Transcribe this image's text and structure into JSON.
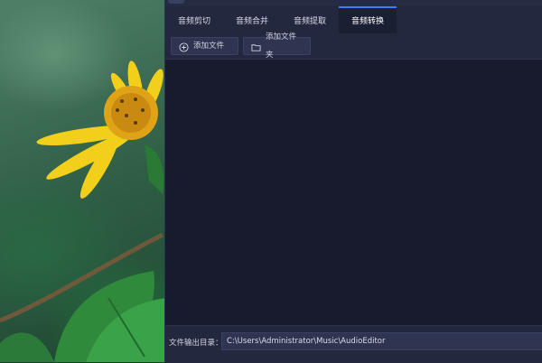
{
  "tabs": [
    {
      "label": "音频剪切",
      "active": false
    },
    {
      "label": "音频合并",
      "active": false
    },
    {
      "label": "音频提取",
      "active": false
    },
    {
      "label": "音频转换",
      "active": true
    }
  ],
  "toolbar": {
    "add_file_label": "添加文件",
    "add_folder_label": "添加文件夹"
  },
  "footer": {
    "output_dir_label": "文件输出目录：",
    "output_dir_value": "C:\\Users\\Administrator\\Music\\AudioEditor"
  },
  "colors": {
    "accent": "#3d7bff",
    "window_bg": "#1b1f33",
    "content_bg": "#171b2d"
  }
}
